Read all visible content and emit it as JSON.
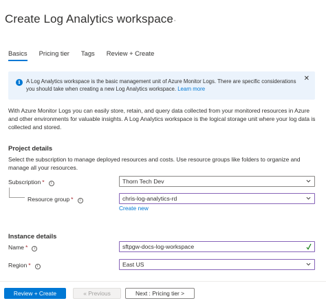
{
  "header": {
    "title": "Create Log Analytics workspace",
    "more_label": "···"
  },
  "tabs": [
    {
      "label": "Basics",
      "active": true
    },
    {
      "label": "Pricing tier",
      "active": false
    },
    {
      "label": "Tags",
      "active": false
    },
    {
      "label": "Review + Create",
      "active": false
    }
  ],
  "info": {
    "text": "A Log Analytics workspace is the basic management unit of Azure Monitor Logs. There are specific considerations you should take when creating a new Log Analytics workspace.",
    "link": "Learn more",
    "close": "✕"
  },
  "description": "With Azure Monitor Logs you can easily store, retain, and query data collected from your monitored resources in Azure and other environments for valuable insights. A Log Analytics workspace is the logical storage unit where your log data is collected and stored.",
  "project": {
    "heading": "Project details",
    "description": "Select the subscription to manage deployed resources and costs. Use resource groups like folders to organize and manage all your resources.",
    "subscription_label": "Subscription",
    "subscription_value": "Thorn Tech Dev",
    "resource_group_label": "Resource group",
    "resource_group_value": "chris-log-analytics-rd",
    "create_new": "Create new"
  },
  "instance": {
    "heading": "Instance details",
    "name_label": "Name",
    "name_value": "sftpgw-docs-log-workspace",
    "region_label": "Region",
    "region_value": "East US"
  },
  "required_marker": "*",
  "help_glyph": "i",
  "info_glyph": "i",
  "footer": {
    "review_create": "Review + Create",
    "previous": "« Previous",
    "next": "Next : Pricing tier >"
  },
  "colors": {
    "accent": "#0078d4",
    "focus_border": "#8764b8",
    "required": "#a4262c",
    "valid_check": "#107c10"
  },
  "icons": [
    "more-icon",
    "info-icon",
    "close-icon",
    "help-icon",
    "chevron-down-icon",
    "checkmark-icon"
  ]
}
